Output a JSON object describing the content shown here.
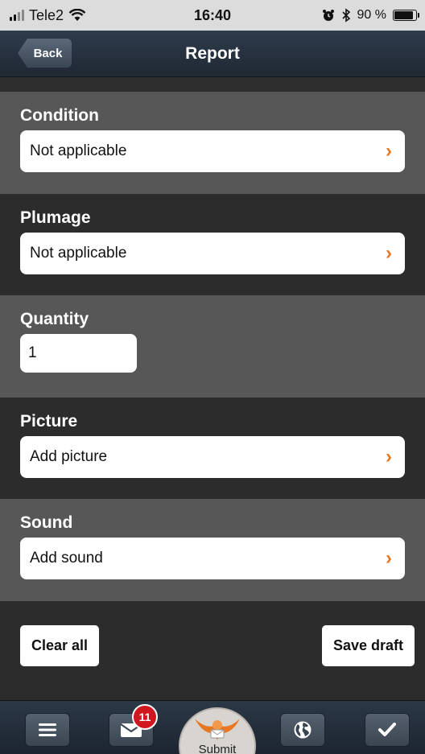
{
  "status_bar": {
    "carrier": "Tele2",
    "time": "16:40",
    "battery": "90 %",
    "battery_level": 0.9
  },
  "nav": {
    "back_label": "Back",
    "title": "Report"
  },
  "fields": {
    "condition": {
      "label": "Condition",
      "value": "Not applicable"
    },
    "plumage": {
      "label": "Plumage",
      "value": "Not applicable"
    },
    "quantity": {
      "label": "Quantity",
      "value": "1"
    },
    "picture": {
      "label": "Picture",
      "value": "Add picture"
    },
    "sound": {
      "label": "Sound",
      "value": "Add sound"
    }
  },
  "actions": {
    "clear_label": "Clear all",
    "save_label": "Save draft"
  },
  "tab_bar": {
    "messages_badge": "11",
    "submit_label": "Submit"
  },
  "colors": {
    "accent": "#e87722",
    "badge": "#d0161f"
  }
}
